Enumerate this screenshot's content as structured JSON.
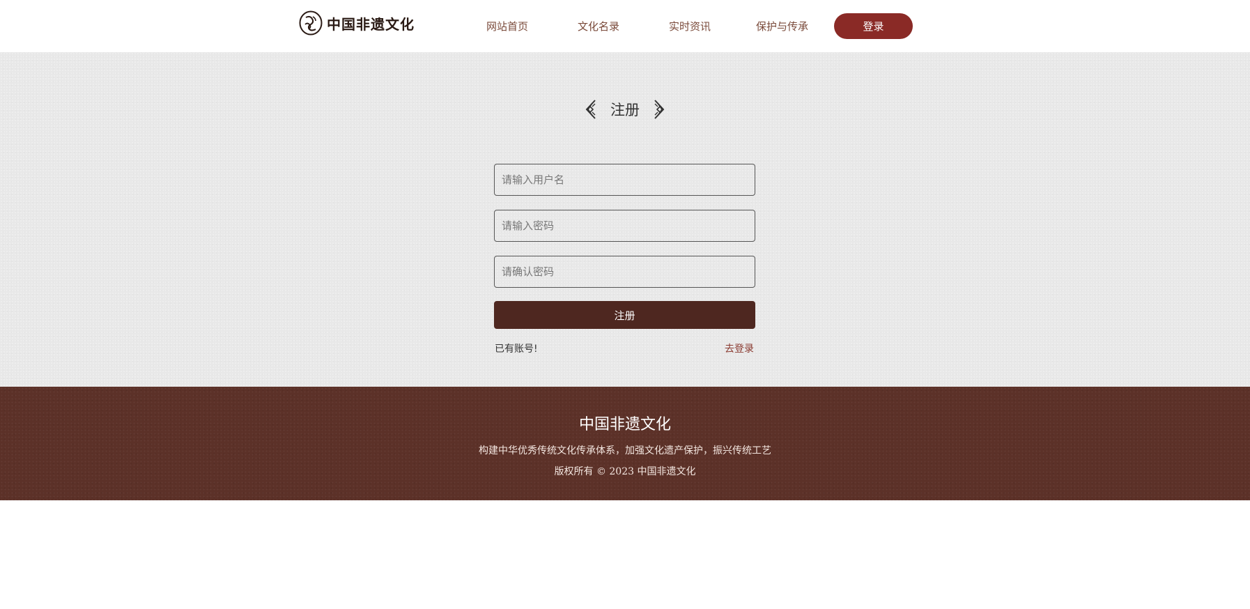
{
  "brand": {
    "name": "中国非遗文化",
    "logo_icon": "seal-icon"
  },
  "nav": {
    "items": [
      {
        "label": "网站首页"
      },
      {
        "label": "文化名录"
      },
      {
        "label": "实时资讯"
      },
      {
        "label": "保护与传承"
      }
    ],
    "login_label": "登录"
  },
  "form": {
    "title": "注册",
    "ornament_left_icon": "lattice-ornament-left-icon",
    "ornament_right_icon": "lattice-ornament-right-icon",
    "username_placeholder": "请输入用户名",
    "password_placeholder": "请输入密码",
    "confirm_placeholder": "请确认密码",
    "username_value": "",
    "password_value": "",
    "confirm_value": "",
    "submit_label": "注册",
    "has_account_text": "已有账号!",
    "go_login_label": "去登录"
  },
  "footer": {
    "title": "中国非遗文化",
    "slogan": "构建中华优秀传统文化传承体系，加强文化遗产保护，振兴传统工艺",
    "copyright": "版权所有 © 2023 中国非遗文化"
  },
  "colors": {
    "accent": "#8a2a26",
    "button_dark": "#4e2720",
    "footer_bg": "#5c3128",
    "nav_text": "#7a4a3a",
    "main_bg": "#e8e8e8"
  }
}
